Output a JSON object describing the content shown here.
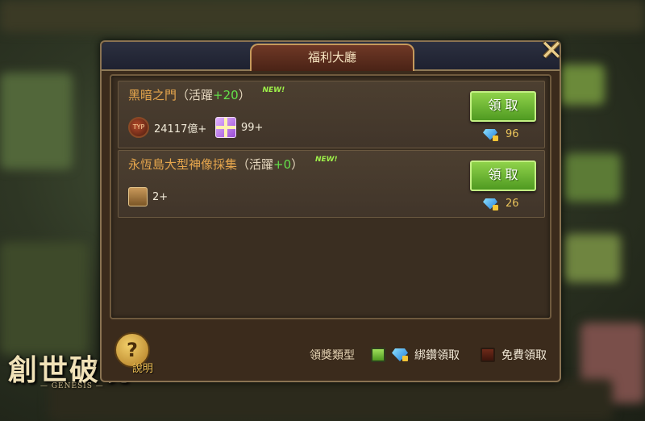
{
  "game": {
    "logo_title": "創世破曉",
    "logo_sub": "— GENESIS —"
  },
  "panel": {
    "title": "福利大廳",
    "close_symbol": "✕"
  },
  "rows": [
    {
      "name": "黑暗之門",
      "activity_prefix": "（活躍",
      "activity_value": "+20",
      "activity_suffix": "）",
      "new_badge": "NEW!",
      "rewards": [
        {
          "icon": "currency-coin-icon",
          "coin_text": "TYP",
          "qty": "24117億+"
        },
        {
          "icon": "gift-box-icon",
          "qty": "99+"
        }
      ],
      "button_label": "領 取",
      "cost": "96",
      "cost_icon": "bound-diamond-icon"
    },
    {
      "name": "永恆島大型神像採集",
      "activity_prefix": "（活躍",
      "activity_value": "+0",
      "activity_suffix": "）",
      "new_badge": "NEW!",
      "rewards": [
        {
          "icon": "treasure-chest-icon",
          "qty": "2+"
        }
      ],
      "button_label": "領 取",
      "cost": "26",
      "cost_icon": "bound-diamond-icon"
    }
  ],
  "footer": {
    "help_symbol": "?",
    "help_label": "說明",
    "legend_title": "領獎類型",
    "legend_bound": "綁鑽領取",
    "legend_free": "免費領取"
  },
  "colors": {
    "accent_green": "#63e04a",
    "name_orange": "#e6a64d",
    "cost_gold": "#e9c35a"
  }
}
